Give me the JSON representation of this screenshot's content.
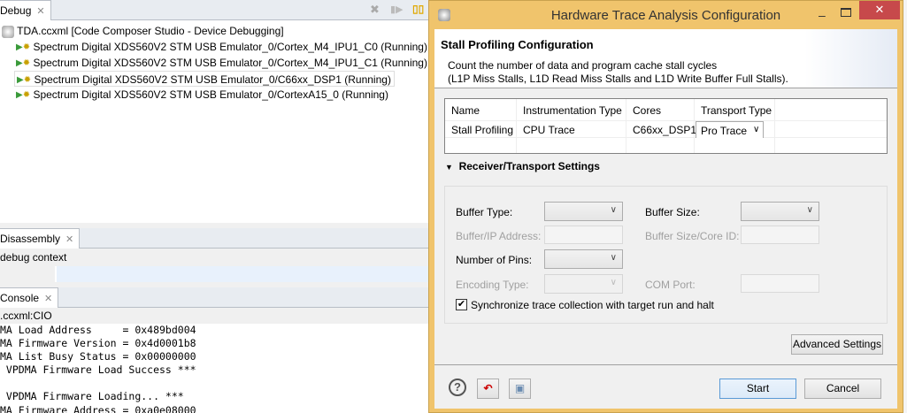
{
  "debug": {
    "tab": "Debug",
    "root": "TDA.ccxml [Code Composer Studio - Device Debugging]",
    "items": [
      "Spectrum Digital XDS560V2 STM USB Emulator_0/Cortex_M4_IPU1_C0 (Running)",
      "Spectrum Digital XDS560V2 STM USB Emulator_0/Cortex_M4_IPU1_C1 (Running)",
      "Spectrum Digital XDS560V2 STM USB Emulator_0/C66xx_DSP1 (Running)",
      "Spectrum Digital XDS560V2 STM USB Emulator_0/CortexA15_0 (Running)"
    ]
  },
  "disassembly": {
    "tab": "Disassembly",
    "message": "debug context"
  },
  "console": {
    "tab": "Console",
    "source": ".ccxml:CIO",
    "lines": [
      "MA Load Address     = 0x489bd004",
      "MA Firmware Version = 0x4d0001b8",
      "MA List Busy Status = 0x00000000",
      " VPDMA Firmware Load Success ***",
      "",
      " VPDMA Firmware Loading... ***",
      "MA Firmware Address = 0xa0e08000"
    ]
  },
  "dialog": {
    "title": "Hardware Trace Analysis Configuration",
    "heading": "Stall Profiling Configuration",
    "desc1": "Count the number of data and program cache stall cycles",
    "desc2": "(L1P Miss Stalls, L1D Read Miss Stalls and L1D Write Buffer Full Stalls).",
    "table": {
      "headers": [
        "Name",
        "Instrumentation Type",
        "Cores",
        "Transport Type"
      ],
      "row": [
        "Stall Profiling",
        "CPU Trace",
        "C66xx_DSP1",
        "Pro Trace"
      ]
    },
    "section": "Receiver/Transport Settings",
    "buffer_type": "Buffer Type:",
    "buffer_size": "Buffer Size:",
    "buffer_ip": "Buffer/IP Address:",
    "buffer_core": "Buffer Size/Core ID:",
    "pins": "Number of Pins:",
    "encoding": "Encoding Type:",
    "com_port": "COM Port:",
    "sync": "Synchronize trace collection with target run and halt",
    "sync_checked": true,
    "advanced": "Advanced Settings",
    "start": "Start",
    "cancel": "Cancel",
    "colors": {
      "frame": "#f0c46c",
      "close": "#c7494b"
    }
  }
}
